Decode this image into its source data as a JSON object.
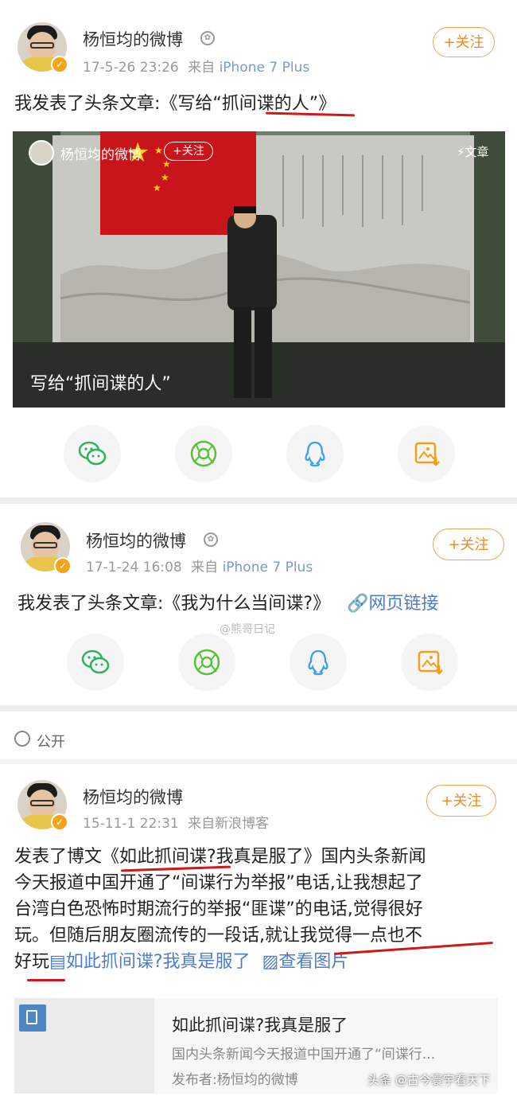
{
  "colors": {
    "accent": "#f08a22",
    "link": "#4d7cc8",
    "verified": "#f3a418"
  },
  "post1": {
    "user": "杨恒均的微博",
    "meta_date": "17-5-26 23:26",
    "meta_from": "来自",
    "meta_device": "iPhone 7 Plus",
    "follow": "+关注",
    "text": "我发表了头条文章:《写给“抓间谍的人”》",
    "card": {
      "user": "杨恒均的微博",
      "follow": "+关注",
      "tag": "文章",
      "caption": "写给“抓间谍的人”"
    }
  },
  "post2": {
    "user": "杨恒均的微博",
    "meta_date": "17-1-24 16:08",
    "meta_from": "来自",
    "meta_device": "iPhone 7 Plus",
    "follow": "+关注",
    "text": "我发表了头条文章:《我为什么当间谍?》",
    "link": "网页链接",
    "watermark": "@熊哥日记"
  },
  "visibility": "公开",
  "post3": {
    "user": "杨恒均的微博",
    "meta_date": "15-11-1 22:31",
    "meta_from": "来自新浪博客",
    "follow": "+关注",
    "lines": [
      "发表了博文《如此抓间谍?我真是服了》国内头条新闻",
      "今天报道中国开通了“间谍行为举报”电话,让我想起了",
      "台湾白色恐怖时期流行的举报“匪谍”的电话,觉得很好",
      "玩。但随后朋友圈流传的一段话,就让我觉得一点也不"
    ],
    "line5_plain": "好玩",
    "line5_link1": "如此抓间谍?我真是服了",
    "line5_link2": "查看图片",
    "card": {
      "title": "如此抓间谍?我真是服了",
      "desc": "国内头条新闻今天报道中国开通了“间谍行...",
      "publisher": "发布者:杨恒均的微博"
    }
  },
  "footer_watermark": "头条 @古今寰宇看天下",
  "icons": [
    "wechat-icon",
    "moments-icon",
    "qq-icon",
    "save-image-icon",
    "globe-icon",
    "link-icon",
    "image-icon",
    "document-icon",
    "verified-icon",
    "medal-icon"
  ]
}
